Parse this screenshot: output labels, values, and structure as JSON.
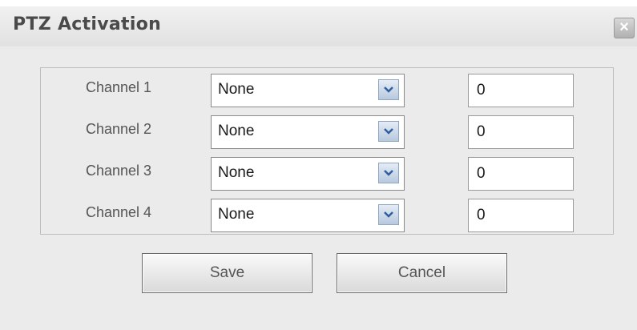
{
  "dialog": {
    "title": "PTZ Activation",
    "close_glyph": "×"
  },
  "channels": [
    {
      "label": "Channel 1",
      "type_value": "None",
      "number_value": "0"
    },
    {
      "label": "Channel 2",
      "type_value": "None",
      "number_value": "0"
    },
    {
      "label": "Channel 3",
      "type_value": "None",
      "number_value": "0"
    },
    {
      "label": "Channel 4",
      "type_value": "None",
      "number_value": "0"
    }
  ],
  "buttons": {
    "save_label": "Save",
    "cancel_label": "Cancel"
  },
  "icons": {
    "close": "close-icon",
    "dropdown": "chevron-down-icon"
  },
  "colors": {
    "background": "#ebebeb",
    "dropdown_accent": "#2f5f9e"
  }
}
